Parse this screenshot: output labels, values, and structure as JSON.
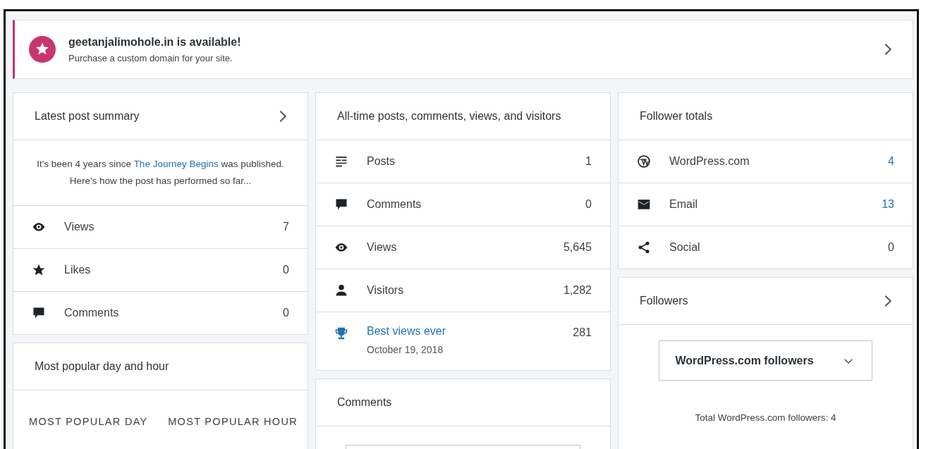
{
  "banner": {
    "title": "geetanjalimohole.in is available!",
    "subtitle": "Purchase a custom domain for your site."
  },
  "latest_post": {
    "title": "Latest post summary",
    "text_before": "It's been 4 years since ",
    "link": "The Journey Begins",
    "text_after": " was published. Here's how the post has performed so far...",
    "rows": [
      {
        "kind": "views",
        "label": "Views",
        "value": "7"
      },
      {
        "kind": "likes",
        "label": "Likes",
        "value": "0"
      },
      {
        "kind": "comments",
        "label": "Comments",
        "value": "0"
      }
    ]
  },
  "popular": {
    "title": "Most popular day and hour",
    "columns": [
      "MOST POPULAR DAY",
      "MOST POPULAR HOUR"
    ]
  },
  "all_time": {
    "title": "All-time posts, comments, views, and visitors",
    "rows": [
      {
        "kind": "posts",
        "label": "Posts",
        "value": "1"
      },
      {
        "kind": "comments",
        "label": "Comments",
        "value": "0"
      },
      {
        "kind": "views",
        "label": "Views",
        "value": "5,645"
      },
      {
        "kind": "visitors",
        "label": "Visitors",
        "value": "1,282"
      },
      {
        "kind": "best",
        "label": "Best views ever",
        "date": "October 19, 2018",
        "value": "281"
      }
    ]
  },
  "comments": {
    "title": "Comments"
  },
  "follower_totals": {
    "title": "Follower totals",
    "rows": [
      {
        "kind": "wordpress",
        "label": "WordPress.com",
        "value": "4",
        "linked": true
      },
      {
        "kind": "email",
        "label": "Email",
        "value": "13",
        "linked": true
      },
      {
        "kind": "social",
        "label": "Social",
        "value": "0",
        "linked": false
      }
    ]
  },
  "followers": {
    "title": "Followers",
    "dropdown": "WordPress.com followers",
    "total": "Total WordPress.com followers: 4"
  }
}
